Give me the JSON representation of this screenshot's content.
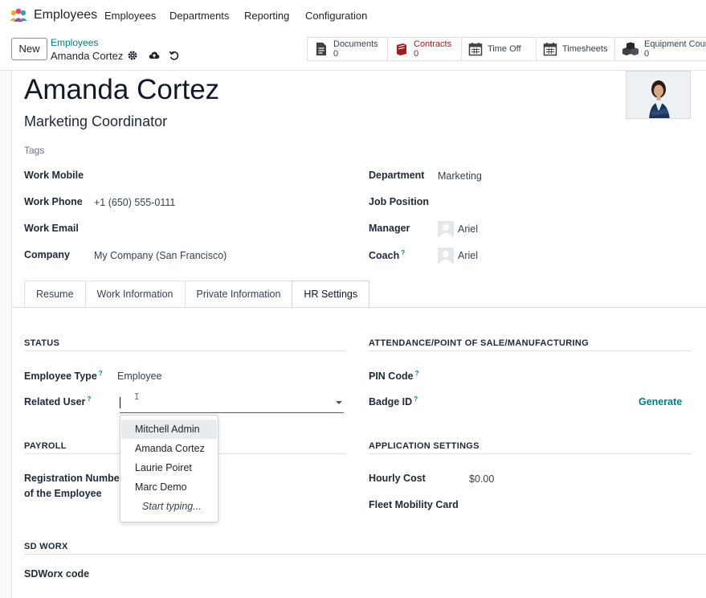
{
  "navbar": {
    "app_name": "Employees",
    "menu": [
      "Employees",
      "Departments",
      "Reporting",
      "Configuration"
    ]
  },
  "control": {
    "new_label": "New",
    "breadcrumb_parent": "Employees",
    "breadcrumb_current": "Amanda Cortez",
    "smart_buttons": [
      {
        "label": "Documents",
        "count": "0",
        "icon": "document-icon"
      },
      {
        "label": "Contracts",
        "count": "0",
        "icon": "book-icon",
        "color": "#a11d1d"
      },
      {
        "label": "Time Off",
        "count": "",
        "icon": "calendar-icon"
      },
      {
        "label": "Timesheets",
        "count": "",
        "icon": "calendar-grid-icon"
      },
      {
        "label": "Equipment Count",
        "count": "0",
        "icon": "boxes-icon"
      }
    ]
  },
  "employee": {
    "name": "Amanda Cortez",
    "job_title": "Marketing Coordinator",
    "tags_placeholder": "Tags"
  },
  "fields": {
    "work_mobile_label": "Work Mobile",
    "work_phone_label": "Work Phone",
    "work_phone_value": "+1 (650) 555-0111",
    "work_email_label": "Work Email",
    "company_label": "Company",
    "company_value": "My Company (San Francisco)",
    "department_label": "Department",
    "department_value": "Marketing",
    "job_position_label": "Job Position",
    "manager_label": "Manager",
    "manager_value": "Ariel",
    "coach_label": "Coach",
    "coach_value": "Ariel",
    "help_mark": "?"
  },
  "tabs": [
    "Resume",
    "Work Information",
    "Private Information",
    "HR Settings"
  ],
  "active_tab": "HR Settings",
  "hr_settings": {
    "status_title": "STATUS",
    "employee_type_label": "Employee Type",
    "employee_type_value": "Employee",
    "related_user_label": "Related User",
    "related_user_options": [
      "Mitchell Admin",
      "Amanda Cortez",
      "Laurie Poiret",
      "Marc Demo"
    ],
    "related_user_more": "Start typing...",
    "payroll_title": "PAYROLL",
    "registration_label_1": "Registration Number",
    "registration_label_2": "of the Employee",
    "attendance_title": "ATTENDANCE/POINT OF SALE/MANUFACTURING",
    "pin_code_label": "PIN Code",
    "badge_id_label": "Badge ID",
    "generate_label": "Generate",
    "app_settings_title": "APPLICATION SETTINGS",
    "hourly_cost_label": "Hourly Cost",
    "hourly_cost_value": "$0.00",
    "fleet_card_label": "Fleet Mobility Card",
    "sdworx_title": "SD WORX",
    "sdworx_code_label": "SDWorx code"
  },
  "colors": {
    "accent": "#017e84",
    "contracts_red": "#a11d1d"
  }
}
